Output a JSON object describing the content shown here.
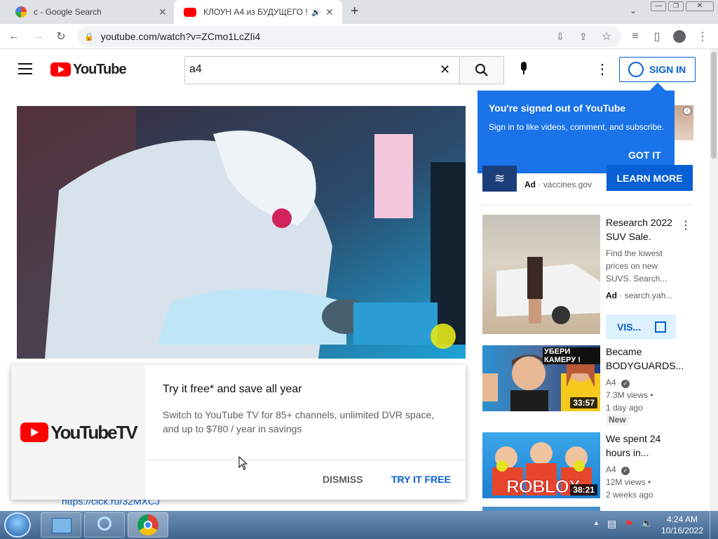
{
  "browser": {
    "tabs": [
      {
        "title": "c - Google Search"
      },
      {
        "title": "КЛОУН А4 из БУДУЩЕГО !"
      }
    ],
    "url": "youtube.com/watch?v=ZCmo1LcZIi4"
  },
  "masthead": {
    "logo_text": "YouTube",
    "search_value": "a4",
    "signin_label": "SIGN IN"
  },
  "tooltip": {
    "title": "You're signed out of YouTube",
    "body": "Sign in to like videos, comment, and subscribe.",
    "button": "GOT IT"
  },
  "ad1": {
    "learn_more": "LEARN MORE",
    "ad_badge": "Ad",
    "domain": "vaccines.gov"
  },
  "ad2": {
    "title": "Research 2022 SUV Sale.",
    "desc": "Find the lowest prices on new SUVS. Search...",
    "ad_badge": "Ad",
    "domain": "search.yah...",
    "visit_label": "VIS..."
  },
  "videos": [
    {
      "title": "Became BODYGUARDS...",
      "channel": "A4",
      "views": "7.3M views",
      "age": "1 day ago",
      "badge": "New",
      "duration": "33:57",
      "thumb_text": "УБЕРИ КАМЕРУ !"
    },
    {
      "title": "We spent 24 hours in...",
      "channel": "A4",
      "views": "12M views",
      "age": "2 weeks ago",
      "duration": "38:21",
      "thumb_text": "ROBLOX"
    }
  ],
  "popup": {
    "logo_text": "YouTubeTV",
    "headline": "Try it free* and save all year",
    "body": "Switch to YouTube TV for 85+ channels, unlimited DVR space, and up to $780 / year in savings",
    "dismiss": "DISMISS",
    "try_free": "TRY IT FREE",
    "link_behind": "https://clck.ru/32MXCJ"
  },
  "taskbar": {
    "time": "4:24 AM",
    "date": "10/16/2022"
  }
}
